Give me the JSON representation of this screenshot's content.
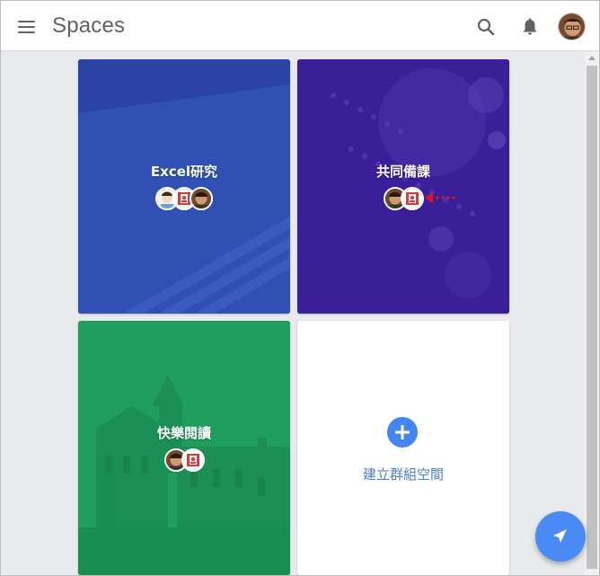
{
  "header": {
    "title": "Spaces",
    "menu_icon": "hamburger-menu-icon",
    "search_icon": "search-icon",
    "notification_icon": "bell-icon",
    "account_avatar": "user-avatar"
  },
  "spaces": [
    {
      "title": "Excel研究",
      "color": "#2e4aae",
      "members": 3
    },
    {
      "title": "共同備課",
      "color": "#3a1f98",
      "members": 2,
      "annotation": "red-dotted-arrow"
    },
    {
      "title": "快樂閱讀",
      "color": "#1f9e5e",
      "members": 2
    }
  ],
  "create_card": {
    "label": "建立群組空間",
    "icon": "plus-circle-icon",
    "accent": "#4285f4"
  },
  "fab": {
    "icon": "send-icon",
    "color": "#4a8af4"
  }
}
